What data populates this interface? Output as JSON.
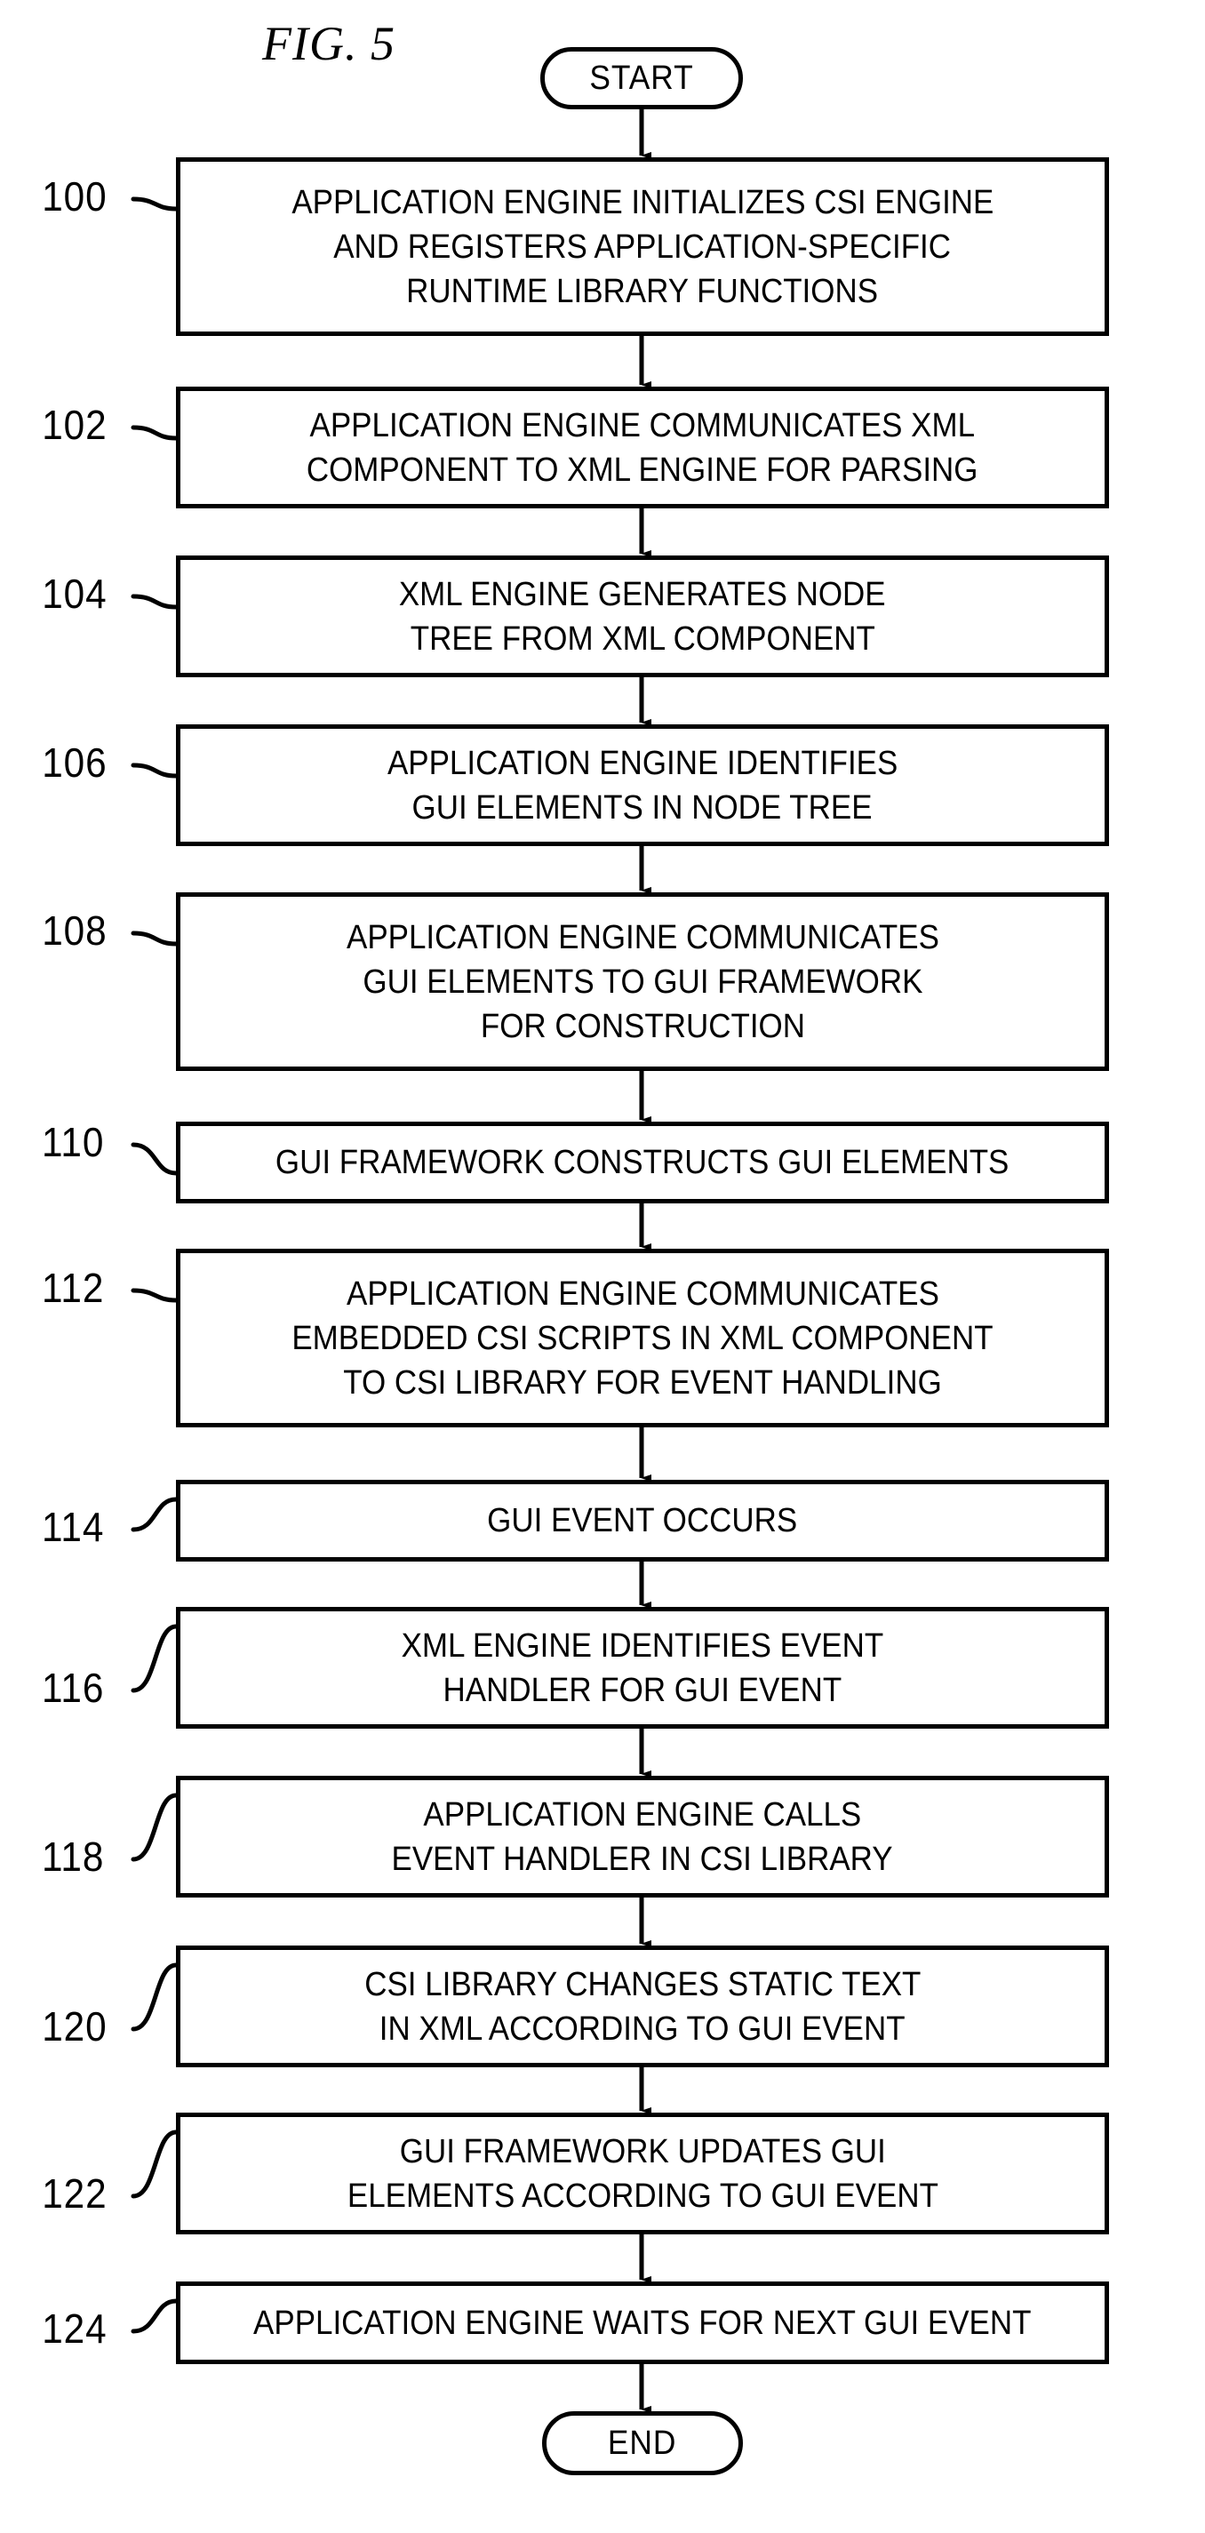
{
  "figure": {
    "title": "FIG. 5"
  },
  "terminators": {
    "start": {
      "label": "START"
    },
    "end": {
      "label": "END"
    }
  },
  "steps": [
    {
      "ref": "100",
      "lines": [
        "APPLICATION ENGINE INITIALIZES CSI ENGINE",
        "AND REGISTERS APPLICATION-SPECIFIC",
        "RUNTIME LIBRARY FUNCTIONS"
      ]
    },
    {
      "ref": "102",
      "lines": [
        "APPLICATION ENGINE COMMUNICATES XML",
        "COMPONENT TO XML ENGINE FOR PARSING"
      ]
    },
    {
      "ref": "104",
      "lines": [
        "XML ENGINE GENERATES NODE",
        "TREE FROM XML COMPONENT"
      ]
    },
    {
      "ref": "106",
      "lines": [
        "APPLICATION ENGINE IDENTIFIES",
        "GUI ELEMENTS IN NODE TREE"
      ]
    },
    {
      "ref": "108",
      "lines": [
        "APPLICATION ENGINE COMMUNICATES",
        "GUI ELEMENTS TO GUI FRAMEWORK",
        "FOR CONSTRUCTION"
      ]
    },
    {
      "ref": "110",
      "lines": [
        "GUI FRAMEWORK CONSTRUCTS GUI ELEMENTS"
      ]
    },
    {
      "ref": "112",
      "lines": [
        "APPLICATION ENGINE COMMUNICATES",
        "EMBEDDED CSI SCRIPTS IN XML COMPONENT",
        "TO CSI LIBRARY FOR EVENT HANDLING"
      ]
    },
    {
      "ref": "114",
      "lines": [
        "GUI EVENT OCCURS"
      ]
    },
    {
      "ref": "116",
      "lines": [
        "XML ENGINE IDENTIFIES EVENT",
        "HANDLER FOR GUI EVENT"
      ]
    },
    {
      "ref": "118",
      "lines": [
        "APPLICATION ENGINE CALLS",
        "EVENT HANDLER IN CSI LIBRARY"
      ]
    },
    {
      "ref": "120",
      "lines": [
        "CSI LIBRARY CHANGES STATIC TEXT",
        "IN XML ACCORDING TO GUI EVENT"
      ]
    },
    {
      "ref": "122",
      "lines": [
        "GUI FRAMEWORK UPDATES GUI",
        "ELEMENTS ACCORDING TO GUI EVENT"
      ]
    },
    {
      "ref": "124",
      "lines": [
        "APPLICATION ENGINE WAITS FOR NEXT GUI EVENT"
      ]
    }
  ],
  "colors": {
    "stroke": "#000000",
    "background": "#ffffff"
  }
}
